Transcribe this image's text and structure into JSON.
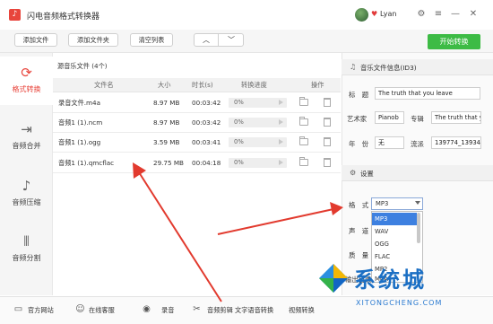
{
  "titlebar": {
    "title": "闪电音频格式转换器",
    "user_name": "Lyan",
    "icons": [
      "app-logo",
      "avatar",
      "vip-heart-icon",
      "settings-icon",
      "menu-icon",
      "minimize-icon",
      "close-icon"
    ]
  },
  "toolbar": {
    "add_file": "添加文件",
    "add_folder": "添加文件夹",
    "clear_list": "清空列表",
    "start": "开始转换",
    "accent": "#3dbb45"
  },
  "sidebar": {
    "items": [
      {
        "label": "格式转换",
        "icon": "convert-icon"
      },
      {
        "label": "音频合并",
        "icon": "merge-icon"
      },
      {
        "label": "音频压缩",
        "icon": "compress-icon"
      },
      {
        "label": "音频分割",
        "icon": "split-icon"
      }
    ],
    "active_color": "#e8453c"
  },
  "file_list": {
    "title": "源音乐文件 (4个)",
    "columns": [
      "文件名",
      "大小",
      "时长(s)",
      "转换进度",
      "操作"
    ],
    "rows": [
      {
        "name": "录音文件.m4a",
        "size": "8.97 MB",
        "duration": "00:03:42",
        "progress": "0%"
      },
      {
        "name": "音频1 (1).ncm",
        "size": "8.97 MB",
        "duration": "00:03:42",
        "progress": "0%"
      },
      {
        "name": "音频1 (1).ogg",
        "size": "3.59 MB",
        "duration": "00:03:41",
        "progress": "0%"
      },
      {
        "name": "音频1 (1).qmcflac",
        "size": "29.75 MB",
        "duration": "00:04:18",
        "progress": "0%"
      }
    ]
  },
  "id3": {
    "heading": "音乐文件信息(ID3)",
    "title_label": "标　题",
    "title_value": "The truth that you leave",
    "artist_label": "艺术家",
    "artist_value": "Pianob",
    "album_label": "专辑",
    "album_value": "The truth that y",
    "year_label": "年　份",
    "year_value": "无",
    "genre_label": "流派",
    "genre_value": "139774_13934"
  },
  "settings": {
    "heading": "设置",
    "format_label": "格　式",
    "format_value": "MP3",
    "channel_label": "声　道",
    "quality_label": "质　量",
    "output_label": "输出目录",
    "options": [
      "MP3",
      "WAV",
      "OGG",
      "FLAC",
      "MP2",
      "M4A"
    ],
    "selected_option": "MP3"
  },
  "bottombar": [
    {
      "label": "官方网站",
      "icon": "website-icon"
    },
    {
      "label": "在线客服",
      "icon": "service-icon"
    },
    {
      "label": "录音",
      "icon": "record-icon"
    },
    {
      "label": "音频剪辑",
      "icon": "cut-icon"
    },
    {
      "label": "文字语音转换",
      "icon": "tts-icon"
    },
    {
      "label": "视频转换",
      "icon": "video-icon"
    }
  ],
  "watermark": {
    "text": "系统城",
    "sub": "XITONGCHENG.COM"
  }
}
